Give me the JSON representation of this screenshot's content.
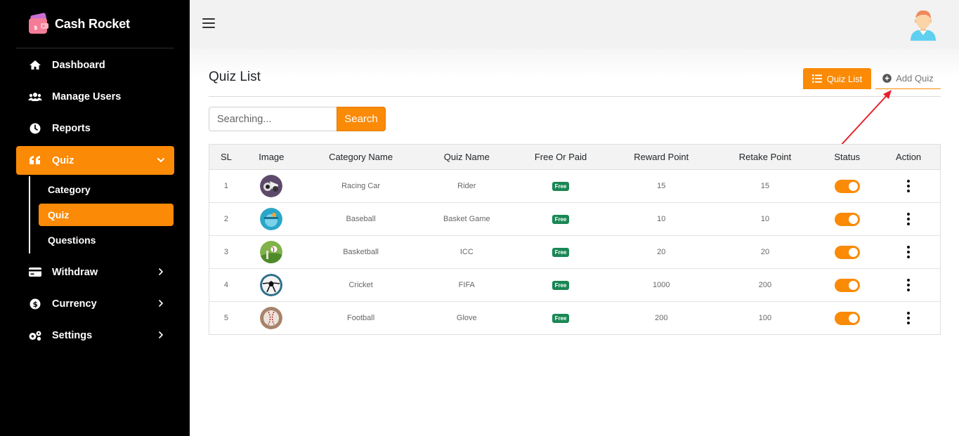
{
  "brand": {
    "name": "Cash Rocket",
    "accent": "#fb8a06"
  },
  "sidebar": {
    "items": [
      {
        "label": "Dashboard",
        "icon": "home-icon"
      },
      {
        "label": "Manage Users",
        "icon": "users-icon"
      },
      {
        "label": "Reports",
        "icon": "clock-icon"
      },
      {
        "label": "Quiz",
        "icon": "quote-icon",
        "active": true,
        "expanded": true
      },
      {
        "label": "Withdraw",
        "icon": "credit-card-icon"
      },
      {
        "label": "Currency",
        "icon": "dollar-circle-icon"
      },
      {
        "label": "Settings",
        "icon": "gears-icon"
      }
    ],
    "quiz_sub": [
      {
        "label": "Category"
      },
      {
        "label": "Quiz",
        "active": true
      },
      {
        "label": "Questions"
      }
    ]
  },
  "page": {
    "title": "Quiz List",
    "tabs": {
      "list_label": "Quiz List",
      "add_label": "Add Quiz"
    }
  },
  "search": {
    "placeholder": "Searching...",
    "button_label": "Search"
  },
  "table": {
    "columns": [
      "SL",
      "Image",
      "Category Name",
      "Quiz Name",
      "Free Or Paid",
      "Reward Point",
      "Retake Point",
      "Status",
      "Action"
    ],
    "rows": [
      {
        "sl": "1",
        "image": "racing-car-thumb",
        "category": "Racing Car",
        "quiz": "Rider",
        "type": "Free",
        "reward": "15",
        "retake": "15",
        "status": "on"
      },
      {
        "sl": "2",
        "image": "baseball-thumb",
        "category": "Baseball",
        "quiz": "Basket Game",
        "type": "Free",
        "reward": "10",
        "retake": "10",
        "status": "on"
      },
      {
        "sl": "3",
        "image": "basketball-thumb",
        "category": "Basketball",
        "quiz": "ICC",
        "type": "Free",
        "reward": "20",
        "retake": "20",
        "status": "on"
      },
      {
        "sl": "4",
        "image": "cricket-thumb",
        "category": "Cricket",
        "quiz": "FIFA",
        "type": "Free",
        "reward": "1000",
        "retake": "200",
        "status": "on"
      },
      {
        "sl": "5",
        "image": "football-thumb",
        "category": "Football",
        "quiz": "Glove",
        "type": "Free",
        "reward": "200",
        "retake": "100",
        "status": "on"
      }
    ]
  }
}
